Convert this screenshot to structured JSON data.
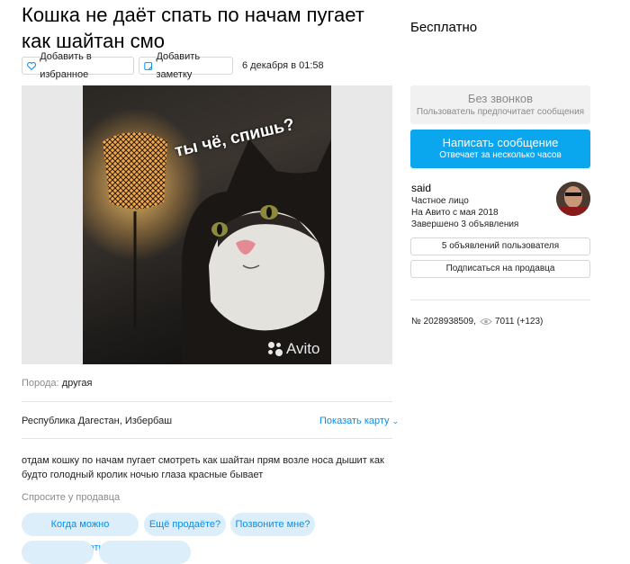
{
  "listing": {
    "title": "Кошка не даёт спать по начам пугает как шайтан смо",
    "price": "Бесплатно",
    "favorite_label": "Добавить в избранное",
    "note_label": "Добавить заметку",
    "date": "6 декабря в 01:58",
    "photo": {
      "caption": "ты чё, спишь?",
      "watermark": "Avito"
    },
    "breed_label": "Порода:",
    "breed_value": "другая",
    "location": "Республика Дагестан, Избербаш",
    "show_map": "Показать карту",
    "description": "отдам кошку по начам пугает смотреть как шайтан прям возле носа дышит как будто голодный кролик ночью глаза красные бывает",
    "ask_seller": "Спросите у продавца",
    "questions": [
      "Когда можно посмотреть?",
      "Ещё продаёте?",
      "Позвоните мне?"
    ]
  },
  "contact": {
    "no_calls_title": "Без звонков",
    "no_calls_sub": "Пользователь предпочитает сообщения",
    "write_title": "Написать сообщение",
    "write_sub": "Отвечает за несколько часов"
  },
  "seller": {
    "name": "said",
    "type": "Частное лицо",
    "since": "На Авито с мая 2018",
    "completed": "Завершено 3 объявления",
    "listings_button": "5 объявлений пользователя",
    "subscribe_button": "Подписаться на продавца"
  },
  "meta": {
    "number": "№ 2028938509,",
    "views": "7011 (+123)"
  },
  "colors": {
    "accent": "#0aa6ee",
    "link": "#0a8ee6",
    "pill_bg": "#dbeefa"
  }
}
